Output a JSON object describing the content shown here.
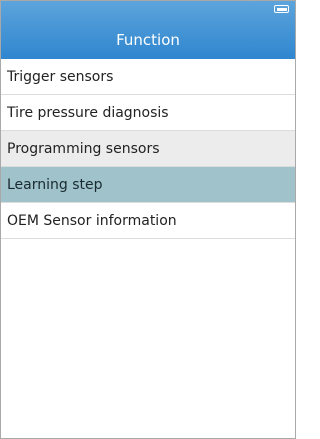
{
  "header": {
    "title": "Function",
    "battery_icon": "battery-icon"
  },
  "menu": {
    "items": [
      {
        "label": "Trigger sensors"
      },
      {
        "label": "Tire pressure diagnosis"
      },
      {
        "label": "Programming sensors"
      },
      {
        "label": "Learning step",
        "selected": true
      },
      {
        "label": "OEM Sensor information"
      }
    ]
  },
  "colors": {
    "header_top": "#5da4dc",
    "header_bottom": "#2f86cf",
    "stripe_row": "#ececec",
    "selected_row": "#9fc2cb"
  }
}
